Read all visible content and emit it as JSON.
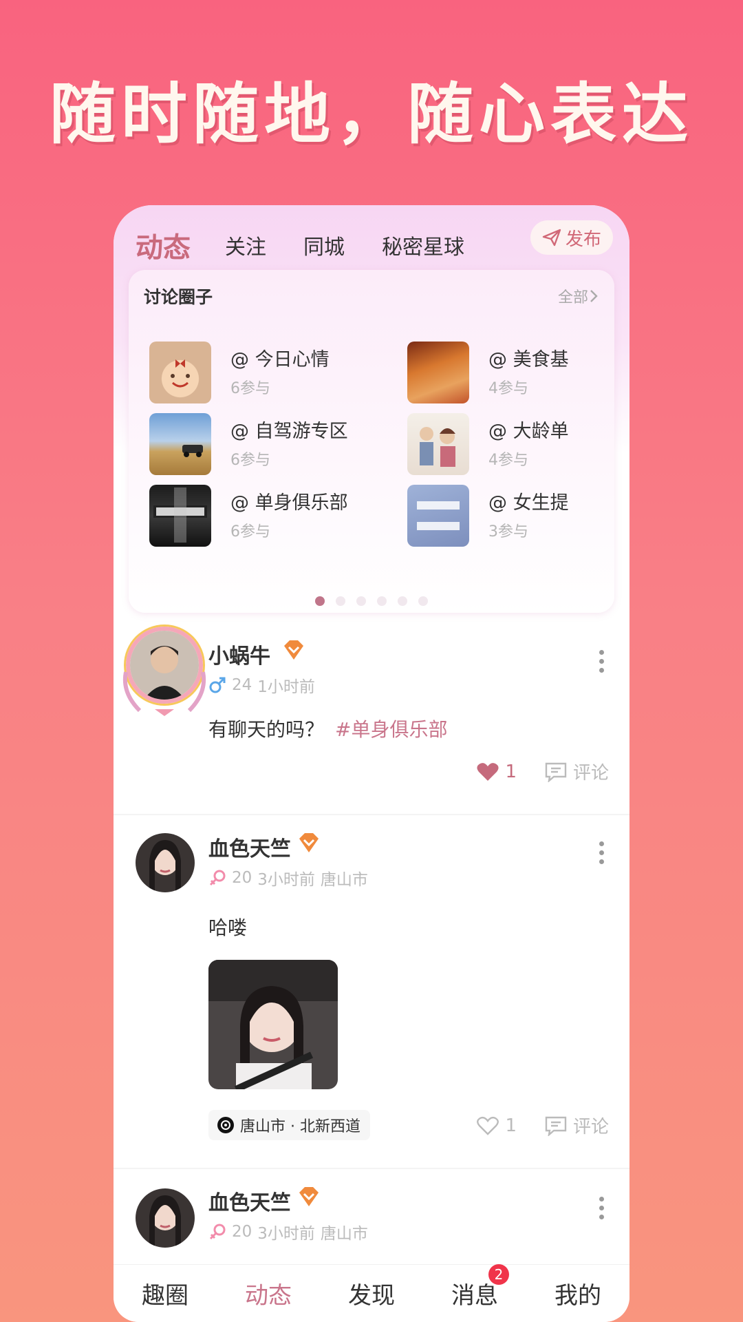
{
  "headline": "随时随地，随心表达",
  "top_tabs": [
    {
      "label": "动态",
      "active": true
    },
    {
      "label": "关注",
      "active": false
    },
    {
      "label": "同城",
      "active": false
    },
    {
      "label": "秘密星球",
      "active": false
    }
  ],
  "publish_label": "发布",
  "circles": {
    "title": "讨论圈子",
    "all_label": "全部",
    "items": [
      {
        "name": "@ 今日心情",
        "count": "6参与"
      },
      {
        "name": "@ 美食基",
        "count": "4参与"
      },
      {
        "name": "@ 自驾游专区",
        "count": "6参与"
      },
      {
        "name": "@ 大龄单",
        "count": "4参与"
      },
      {
        "name": "@ 单身俱乐部",
        "count": "6参与"
      },
      {
        "name": "@ 女生提",
        "count": "3参与"
      }
    ],
    "page_count": 6,
    "active_page": 1
  },
  "posts": [
    {
      "username": "小蜗牛",
      "gender": "male",
      "age": "24",
      "time": "1小时前",
      "city": "",
      "text": "有聊天的吗？",
      "tag": "#单身俱乐部",
      "likes": "1",
      "liked": true,
      "comment_label": "评论"
    },
    {
      "username": "血色天竺",
      "gender": "female",
      "age": "20",
      "time": "3小时前",
      "city": "唐山市",
      "text": "哈喽",
      "location": "唐山市 · 北新西道",
      "likes": "1",
      "liked": false,
      "comment_label": "评论"
    },
    {
      "username": "血色天竺",
      "gender": "female",
      "age": "20",
      "time": "3小时前",
      "city": "唐山市"
    }
  ],
  "bottom_nav": [
    {
      "label": "趣圈",
      "active": false
    },
    {
      "label": "动态",
      "active": true
    },
    {
      "label": "发现",
      "active": false
    },
    {
      "label": "消息",
      "active": false,
      "badge": "2"
    },
    {
      "label": "我的",
      "active": false
    }
  ],
  "colors": {
    "accent": "#c9758b",
    "background_top": "#f9637f",
    "background_bottom": "#f9957e",
    "badge": "#f0344a"
  }
}
